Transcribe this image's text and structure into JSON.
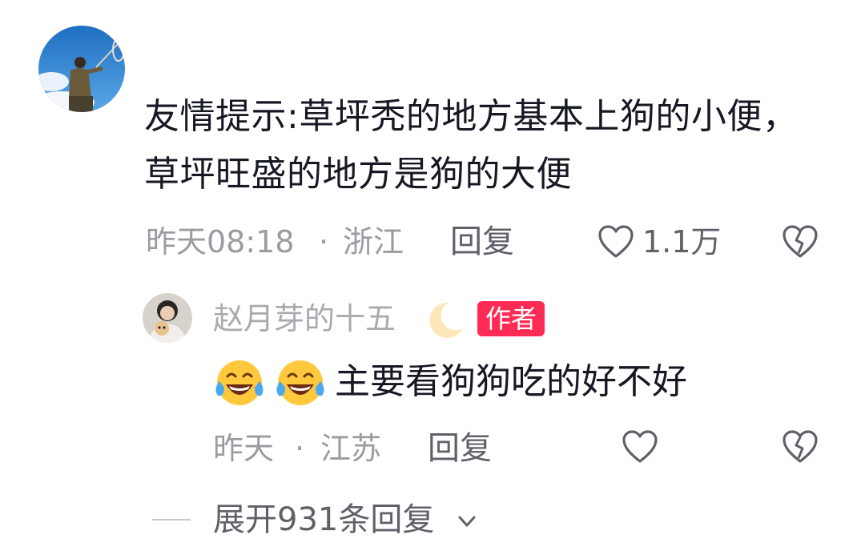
{
  "comment": {
    "text": "友情提示:草坪秃的地方基本上狗的小便，草坪旺盛的地方是狗的大便",
    "time": "昨天08:18",
    "separator": "·",
    "location": "浙江",
    "reply_label": "回复",
    "like_count": "1.1万",
    "icons": [
      "avatar-photo",
      "heart-icon",
      "broken-heart-icon"
    ]
  },
  "reply": {
    "username": "赵月芽的十五",
    "badge": "作者",
    "text": "主要看狗狗吃的好不好",
    "emoji_count": 2,
    "time": "昨天",
    "separator": "·",
    "location": "江苏",
    "reply_label": "回复",
    "icons": [
      "crescent-moon-icon",
      "tears-of-joy-emoji",
      "heart-icon",
      "broken-heart-icon"
    ]
  },
  "expand": {
    "label": "展开931条回复",
    "icon": "chevron-down-icon"
  },
  "colors": {
    "badge": "#fe2c55",
    "meta_gray": "#9b9ca2",
    "action_gray": "#5f6068",
    "text": "#161823"
  }
}
